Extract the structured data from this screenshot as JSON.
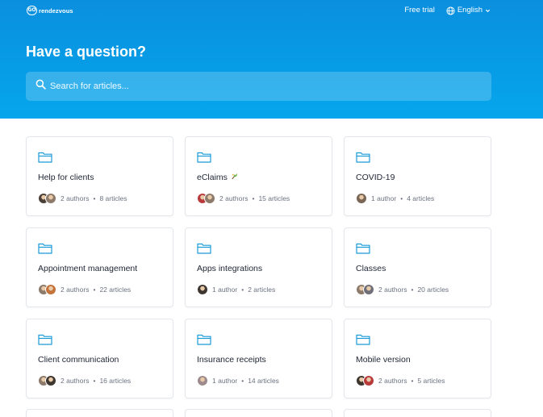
{
  "header": {
    "logo_mark": "GO",
    "logo_text": "rendezvous",
    "free_trial": "Free trial",
    "language": "English"
  },
  "hero": {
    "title": "Have a question?",
    "search_placeholder": "Search for articles..."
  },
  "colors": {
    "hero_top": "#0a8fde",
    "hero_bottom": "#05a6ec",
    "folder_icon": "#1a9bd7",
    "title_text": "#1d2433",
    "meta_text": "#6b7280"
  },
  "collections": [
    {
      "title": "Help for clients",
      "authors": "2 authors",
      "articles": "8 articles",
      "avatar_colors": [
        "#4a3f36",
        "#8c7a6b"
      ]
    },
    {
      "title": "eClaims",
      "authors": "2 authors",
      "articles": "15 articles",
      "avatar_colors": [
        "#b83a3a",
        "#8c7a6b"
      ],
      "badge_icon": "sparkle-icon"
    },
    {
      "title": "COVID-19",
      "authors": "1 author",
      "articles": "4 articles",
      "avatar_colors": [
        "#7a6656"
      ]
    },
    {
      "title": "Appointment management",
      "authors": "2 authors",
      "articles": "22 articles",
      "avatar_colors": [
        "#8c7a6b",
        "#c4733a"
      ]
    },
    {
      "title": "Apps integrations",
      "authors": "1 author",
      "articles": "2 articles",
      "avatar_colors": [
        "#3d3530"
      ]
    },
    {
      "title": "Classes",
      "authors": "2 authors",
      "articles": "20 articles",
      "avatar_colors": [
        "#8c7a6b",
        "#6f6f7a"
      ]
    },
    {
      "title": "Client communication",
      "authors": "2 authors",
      "articles": "16 articles",
      "avatar_colors": [
        "#8c7a6b",
        "#3d3530"
      ]
    },
    {
      "title": "Insurance receipts",
      "authors": "1 author",
      "articles": "14 articles",
      "avatar_colors": [
        "#9c8a8c"
      ]
    },
    {
      "title": "Mobile version",
      "authors": "2 authors",
      "articles": "5 articles",
      "avatar_colors": [
        "#3d3530",
        "#b83a3a"
      ]
    }
  ]
}
